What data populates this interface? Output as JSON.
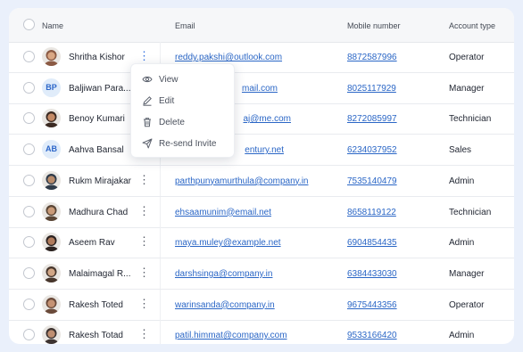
{
  "columns": {
    "name": "Name",
    "email": "Email",
    "mobile": "Mobile number",
    "account_type": "Account type"
  },
  "rows": [
    {
      "name": "Shritha Kishor",
      "avatar": "photo",
      "email": "reddy.pakshi@outlook.com",
      "mobile": "8872587996",
      "account_type": "Operator"
    },
    {
      "name": "Baljiwan Para...",
      "avatar": "initials",
      "initials": "BP",
      "email": "mail.com",
      "mobile": "8025117929",
      "account_type": "Manager"
    },
    {
      "name": "Benoy Kumari",
      "avatar": "photo",
      "email": "aj@me.com",
      "mobile": "8272085997",
      "account_type": "Technician"
    },
    {
      "name": "Aahva Bansal",
      "avatar": "initials",
      "initials": "AB",
      "email": "entury.net",
      "mobile": "6234037952",
      "account_type": "Sales"
    },
    {
      "name": "Rukm Mirajakar",
      "avatar": "photo",
      "email": "parthpunyamurthula@company.in",
      "mobile": "7535140479",
      "account_type": "Admin"
    },
    {
      "name": "Madhura Chad",
      "avatar": "photo",
      "email": "ehsaamunim@email.net",
      "mobile": "8658119122",
      "account_type": "Technician"
    },
    {
      "name": "Aseem Rav",
      "avatar": "photo",
      "email": "maya.muley@example.net",
      "mobile": "6904854435",
      "account_type": "Admin"
    },
    {
      "name": "Malaimagal R...",
      "avatar": "photo",
      "email": "darshsinga@company.in",
      "mobile": "6384433030",
      "account_type": "Manager"
    },
    {
      "name": "Rakesh Toted",
      "avatar": "photo",
      "email": "warinsanda@company.in",
      "mobile": "9675443356",
      "account_type": "Operator"
    },
    {
      "name": "Rakesh Totad",
      "avatar": "photo",
      "email": "patil.himmat@company.com",
      "mobile": "9533166420",
      "account_type": "Admin"
    }
  ],
  "context_menu": {
    "items": [
      {
        "label": "View",
        "icon": "eye-icon"
      },
      {
        "label": "Edit",
        "icon": "pencil-icon"
      },
      {
        "label": "Delete",
        "icon": "trash-icon"
      },
      {
        "label": "Re-send Invite",
        "icon": "send-icon"
      }
    ]
  },
  "colors": {
    "link": "#2a66c6",
    "accent": "#2f6fe0",
    "background": "#eaf0fb",
    "initials_bg": "#e0ecfa"
  }
}
